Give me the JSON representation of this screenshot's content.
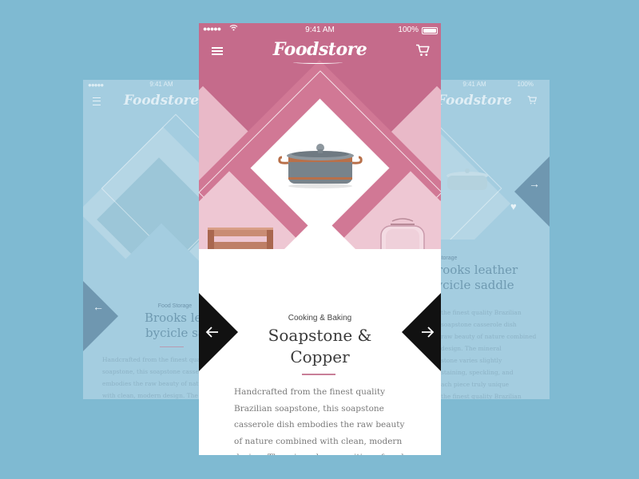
{
  "status_bar": {
    "time": "9:41 AM",
    "battery": "100%"
  },
  "app": {
    "logo": "Foodstore"
  },
  "product": {
    "category": "Cooking & Baking",
    "title_line1": "Soapstone &",
    "title_line2": "Copper",
    "description": "Handcrafted from the finest quality Brazilian soapstone, this soapstone casserole dish embodies the raw beauty of nature combined with clean, modern design. The mineral composition of each stone varies slightly,"
  },
  "left_preview": {
    "time": "9:41 AM",
    "logo": "Foodstore",
    "category": "Food Storage",
    "title_line1": "Brooks leath",
    "title_line2": "bycicle sadd",
    "description_lines": [
      "Handcrafted from the finest quality Brazi",
      "soapstone, this soapstone casse",
      "embodies the raw beauty of natur",
      "with clean, modern design. The m"
    ]
  },
  "right_preview": {
    "time": "9:41 AM",
    "battery": "100%",
    "logo": "Foodstore",
    "category": "Food Storage",
    "title_line1": "Brooks leather",
    "title_line2": "bycicle saddle",
    "description_lines": [
      "the finest quality Brazilian",
      "soapstone casserole dish",
      "raw beauty of nature combined",
      "design. The mineral",
      "stone varies slightly",
      "staining, speckling, and",
      "ach piece truly unique",
      "the finest quality Brazilian"
    ]
  },
  "colors": {
    "background": "#7fbad2",
    "hero_pink": "#c56b8b",
    "accent_rule": "#c87f98"
  }
}
